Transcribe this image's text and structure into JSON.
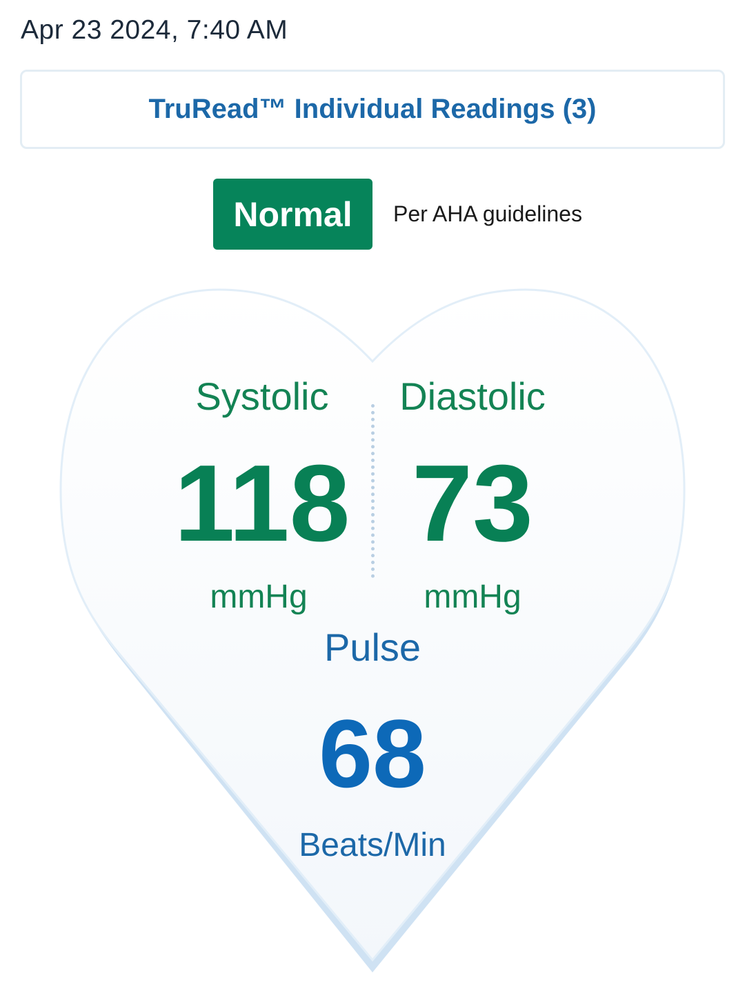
{
  "header": {
    "timestamp": "Apr 23 2024, 7:40 AM"
  },
  "readings_button": {
    "label": "TruRead™ Individual Readings (3)"
  },
  "status": {
    "badge": "Normal",
    "note": "Per AHA guidelines",
    "badge_color": "#06845a"
  },
  "reading": {
    "systolic": {
      "label": "Systolic",
      "value": "118",
      "unit": "mmHg"
    },
    "diastolic": {
      "label": "Diastolic",
      "value": "73",
      "unit": "mmHg"
    },
    "pulse": {
      "label": "Pulse",
      "value": "68",
      "unit": "Beats/Min"
    }
  },
  "colors": {
    "bp_green": "#088055",
    "pulse_blue": "#0d69b8",
    "heart_fill": "#f6f9fc",
    "heart_edge": "#cfe2f3"
  },
  "icons": [
    "heart-icon"
  ]
}
